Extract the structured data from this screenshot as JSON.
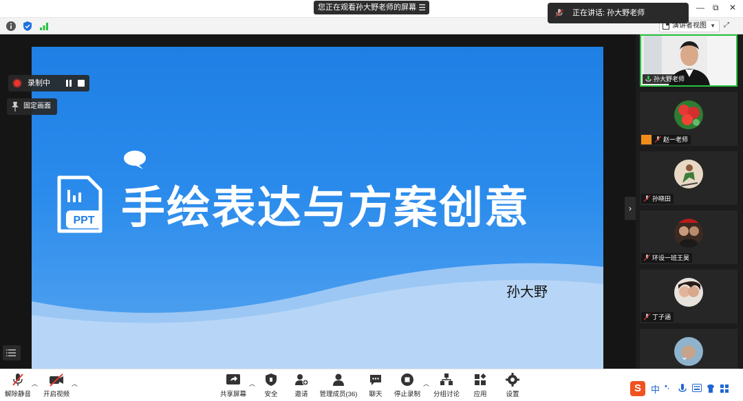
{
  "titlebar": {
    "share_banner": "您正在观看孙大野老师的屏幕",
    "speaking_text": "正在讲话: 孙大野老师"
  },
  "infobar": {
    "view_select": "演讲者视图"
  },
  "recording": {
    "label": "录制中"
  },
  "pin": {
    "label": "固定画面"
  },
  "slide": {
    "title": "手绘表达与方案创意",
    "author": "孙大野",
    "icon_text": "PPT"
  },
  "gallery": {
    "participants": [
      {
        "name": "孙大野老师"
      },
      {
        "name": "赵一老师"
      },
      {
        "name": "孙晓田"
      },
      {
        "name": "环设一班王昊"
      },
      {
        "name": "丁子涵"
      }
    ]
  },
  "toolbar": {
    "unmute": "解除静音",
    "start_video": "开启视频",
    "share_screen": "共享屏幕",
    "security": "安全",
    "invite": "邀请",
    "participants": "管理成员(36)",
    "chat": "聊天",
    "stop_recording": "停止录制",
    "breakout": "分组讨论",
    "apps": "应用",
    "settings": "设置"
  },
  "ime": {
    "lang": "中"
  },
  "colors": {
    "slide_blue": "#1f7fe4",
    "record_red": "#e8352e",
    "active_green": "#26c43d",
    "sogou_orange": "#f0531f"
  }
}
